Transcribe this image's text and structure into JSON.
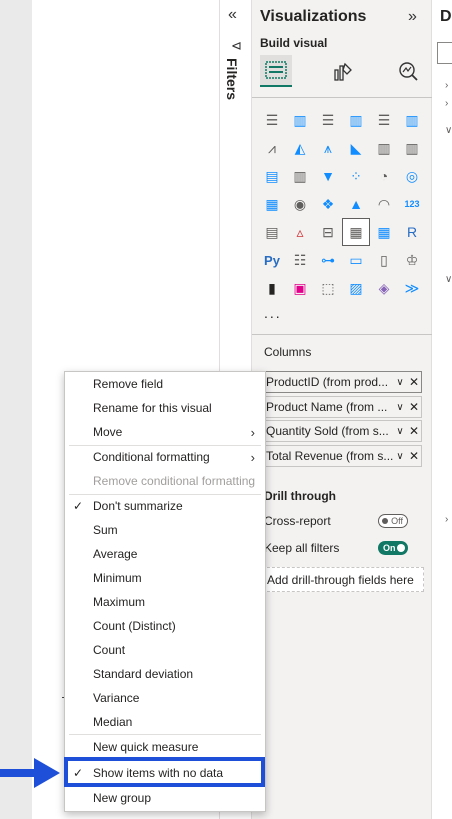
{
  "filters_pane": {
    "label": "Filters",
    "collapse_glyph": "«",
    "funnel_glyph": "⊲"
  },
  "visualizations": {
    "title": "Visualizations",
    "expand_glyph": "»",
    "build_label": "Build visual",
    "build_buttons": [
      "build-visual-icon",
      "format-visual-icon",
      "analytics-icon"
    ],
    "icons": [
      {
        "name": "stacked-bar-chart-icon",
        "glyph": "☰",
        "color": "#605e5c"
      },
      {
        "name": "stacked-column-chart-icon",
        "glyph": "▥",
        "color": "#118dff"
      },
      {
        "name": "clustered-bar-chart-icon",
        "glyph": "☰",
        "color": "#605e5c"
      },
      {
        "name": "clustered-column-chart-icon",
        "glyph": "▥",
        "color": "#118dff"
      },
      {
        "name": "100-stacked-bar-chart-icon",
        "glyph": "☰",
        "color": "#605e5c"
      },
      {
        "name": "100-stacked-column-chart-icon",
        "glyph": "▥",
        "color": "#118dff"
      },
      {
        "name": "line-chart-icon",
        "glyph": "⩘",
        "color": "#605e5c"
      },
      {
        "name": "area-chart-icon",
        "glyph": "◭",
        "color": "#118dff"
      },
      {
        "name": "stacked-area-chart-icon",
        "glyph": "⩚",
        "color": "#118dff"
      },
      {
        "name": "100-stacked-area-chart-icon",
        "glyph": "◣",
        "color": "#118dff"
      },
      {
        "name": "line-stacked-column-chart-icon",
        "glyph": "▥",
        "color": "#605e5c"
      },
      {
        "name": "line-clustered-column-chart-icon",
        "glyph": "▥",
        "color": "#605e5c"
      },
      {
        "name": "ribbon-chart-icon",
        "glyph": "▤",
        "color": "#118dff"
      },
      {
        "name": "waterfall-chart-icon",
        "glyph": "▥",
        "color": "#605e5c"
      },
      {
        "name": "funnel-chart-icon",
        "glyph": "▼",
        "color": "#118dff"
      },
      {
        "name": "scatter-chart-icon",
        "glyph": "⁘",
        "color": "#118dff"
      },
      {
        "name": "pie-chart-icon",
        "glyph": "◔",
        "color": "#605e5c"
      },
      {
        "name": "donut-chart-icon",
        "glyph": "◎",
        "color": "#118dff"
      },
      {
        "name": "treemap-icon",
        "glyph": "▦",
        "color": "#118dff"
      },
      {
        "name": "map-icon",
        "glyph": "◉",
        "color": "#605e5c"
      },
      {
        "name": "filled-map-icon",
        "glyph": "❖",
        "color": "#118dff"
      },
      {
        "name": "azure-map-icon",
        "glyph": "▲",
        "color": "#118dff"
      },
      {
        "name": "gauge-icon",
        "glyph": "◠",
        "color": "#605e5c"
      },
      {
        "name": "card-icon",
        "glyph": "123",
        "color": "#118dff"
      },
      {
        "name": "multi-row-card-icon",
        "glyph": "▤",
        "color": "#605e5c"
      },
      {
        "name": "kpi-icon",
        "glyph": "▵",
        "color": "#d13438"
      },
      {
        "name": "slicer-icon",
        "glyph": "⊟",
        "color": "#605e5c"
      },
      {
        "name": "table-icon",
        "glyph": "▦",
        "color": "#605e5c"
      },
      {
        "name": "matrix-icon",
        "glyph": "▦",
        "color": "#118dff"
      },
      {
        "name": "r-visual-icon",
        "glyph": "R",
        "color": "#276dc3"
      },
      {
        "name": "python-visual-icon",
        "glyph": "Py",
        "color": "#276dc3"
      },
      {
        "name": "key-influencers-icon",
        "glyph": "☷",
        "color": "#605e5c"
      },
      {
        "name": "decomposition-tree-icon",
        "glyph": "⊶",
        "color": "#118dff"
      },
      {
        "name": "qa-icon",
        "glyph": "▭",
        "color": "#118dff"
      },
      {
        "name": "smart-narrative-icon",
        "glyph": "▯",
        "color": "#605e5c"
      },
      {
        "name": "goals-icon",
        "glyph": "♔",
        "color": "#605e5c"
      },
      {
        "name": "paginated-report-icon",
        "glyph": "▮",
        "color": "#252423"
      },
      {
        "name": "power-apps-icon",
        "glyph": "▣",
        "color": "#e3008c"
      },
      {
        "name": "power-automate-icon",
        "glyph": "⬚",
        "color": "#605e5c"
      },
      {
        "name": "custom-visual-1-icon",
        "glyph": "▨",
        "color": "#118dff"
      },
      {
        "name": "custom-visual-2-icon",
        "glyph": "◈",
        "color": "#8764b8"
      },
      {
        "name": "custom-visual-3-icon",
        "glyph": "≫",
        "color": "#118dff"
      }
    ],
    "more_glyph": "...",
    "columns_label": "Columns",
    "fields": [
      {
        "label": "ProductID (from prod..."
      },
      {
        "label": "Product Name (from ..."
      },
      {
        "label": "Quantity Sold (from s..."
      },
      {
        "label": "Total Revenue (from s..."
      }
    ],
    "chevron_glyph": "∨",
    "remove_glyph": "✕",
    "drill_through_label": "Drill through",
    "cross_report_label": "Cross-report",
    "cross_report_toggle": "Off",
    "keep_filters_label": "Keep all filters",
    "keep_filters_toggle": "On",
    "drill_well_text": "Add drill-through fields here"
  },
  "data_pane": {
    "title_initial": "D"
  },
  "context_menu": {
    "items": [
      {
        "label": "Remove field",
        "checked": false,
        "submenu": false,
        "disabled": false
      },
      {
        "label": "Rename for this visual",
        "checked": false,
        "submenu": false,
        "disabled": false
      },
      {
        "label": "Move",
        "checked": false,
        "submenu": true,
        "disabled": false
      },
      {
        "label": "Conditional formatting",
        "checked": false,
        "submenu": true,
        "disabled": false
      },
      {
        "label": "Remove conditional formatting",
        "checked": false,
        "submenu": false,
        "disabled": true
      },
      {
        "label": "Don't summarize",
        "checked": true,
        "submenu": false,
        "disabled": false
      },
      {
        "label": "Sum",
        "checked": false,
        "submenu": false,
        "disabled": false
      },
      {
        "label": "Average",
        "checked": false,
        "submenu": false,
        "disabled": false
      },
      {
        "label": "Minimum",
        "checked": false,
        "submenu": false,
        "disabled": false
      },
      {
        "label": "Maximum",
        "checked": false,
        "submenu": false,
        "disabled": false
      },
      {
        "label": "Count (Distinct)",
        "checked": false,
        "submenu": false,
        "disabled": false
      },
      {
        "label": "Count",
        "checked": false,
        "submenu": false,
        "disabled": false
      },
      {
        "label": "Standard deviation",
        "checked": false,
        "submenu": false,
        "disabled": false
      },
      {
        "label": "Variance",
        "checked": false,
        "submenu": false,
        "disabled": false
      },
      {
        "label": "Median",
        "checked": false,
        "submenu": false,
        "disabled": false
      },
      {
        "label": "New quick measure",
        "checked": false,
        "submenu": false,
        "disabled": false
      },
      {
        "label": "Show items with no data",
        "checked": true,
        "submenu": false,
        "disabled": false
      },
      {
        "label": "New group",
        "checked": false,
        "submenu": false,
        "disabled": false
      }
    ],
    "check_glyph": "✓",
    "submenu_glyph": "›"
  },
  "colors": {
    "accent": "#117865",
    "highlight": "#1e4fd8"
  }
}
